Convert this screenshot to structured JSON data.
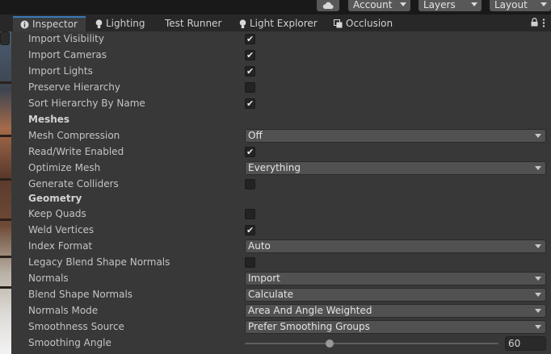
{
  "toolbar": {
    "cloud_icon": "cloud-icon",
    "account_label": "Account",
    "layers_label": "Layers",
    "layout_label": "Layout"
  },
  "tabs": [
    {
      "label": "Inspector",
      "icon": "info-icon",
      "active": true
    },
    {
      "label": "Lighting",
      "icon": "lightbulb-icon",
      "active": false
    },
    {
      "label": "Test Runner",
      "icon": "",
      "active": false
    },
    {
      "label": "Light Explorer",
      "icon": "lightbulb-icon",
      "active": false
    },
    {
      "label": "Occlusion",
      "icon": "occlusion-icon",
      "active": false
    }
  ],
  "rows": [
    {
      "label": "Import Visibility",
      "type": "checkbox",
      "checked": true
    },
    {
      "label": "Import Cameras",
      "type": "checkbox",
      "checked": true
    },
    {
      "label": "Import Lights",
      "type": "checkbox",
      "checked": true
    },
    {
      "label": "Preserve Hierarchy",
      "type": "checkbox",
      "checked": false
    },
    {
      "label": "Sort Hierarchy By Name",
      "type": "checkbox",
      "checked": true
    },
    {
      "label": "Meshes",
      "type": "header"
    },
    {
      "label": "Mesh Compression",
      "type": "dropdown",
      "value": "Off"
    },
    {
      "label": "Read/Write Enabled",
      "type": "checkbox",
      "checked": true
    },
    {
      "label": "Optimize Mesh",
      "type": "dropdown",
      "value": "Everything"
    },
    {
      "label": "Generate Colliders",
      "type": "checkbox",
      "checked": false
    },
    {
      "label": "Geometry",
      "type": "header"
    },
    {
      "label": "Keep Quads",
      "type": "checkbox",
      "checked": false
    },
    {
      "label": "Weld Vertices",
      "type": "checkbox",
      "checked": true
    },
    {
      "label": "Index Format",
      "type": "dropdown",
      "value": "Auto"
    },
    {
      "label": "Legacy Blend Shape Normals",
      "type": "checkbox",
      "checked": false
    },
    {
      "label": "Normals",
      "type": "dropdown",
      "value": "Import"
    },
    {
      "label": "Blend Shape Normals",
      "type": "dropdown",
      "value": "Calculate"
    },
    {
      "label": "Normals Mode",
      "type": "dropdown",
      "value": "Area And Angle Weighted"
    },
    {
      "label": "Smoothness Source",
      "type": "dropdown",
      "value": "Prefer Smoothing Groups"
    },
    {
      "label": "Smoothing Angle",
      "type": "slider",
      "value": "60",
      "fraction": 0.333
    }
  ],
  "colors": {
    "accent": "#3a79bb",
    "background": "#383838",
    "toolbar": "#191919"
  }
}
